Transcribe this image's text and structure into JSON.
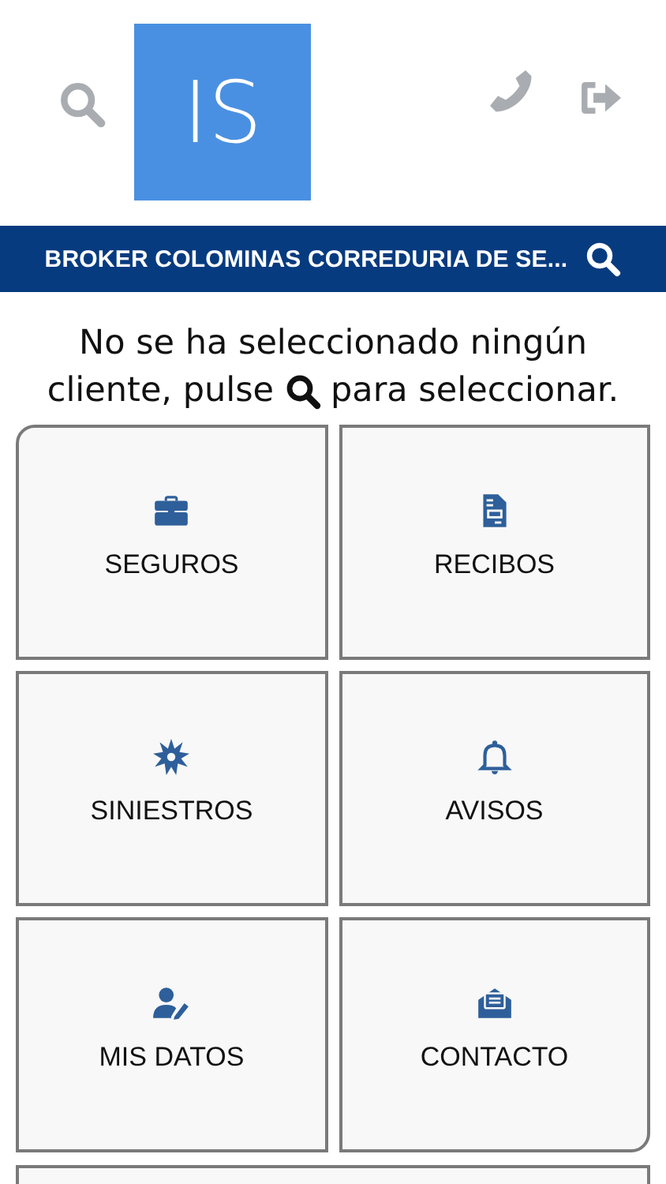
{
  "header": {
    "logo": "IS"
  },
  "client_bar": {
    "title": "BROKER COLOMINAS CORREDURIA DE SE..."
  },
  "message": {
    "line_1": "No se ha seleccionado ningún",
    "before_icon": "cliente, pulse",
    "after_icon": "para seleccionar."
  },
  "tiles": [
    {
      "label": "SEGUROS"
    },
    {
      "label": "RECIBOS"
    },
    {
      "label": "SINIESTROS"
    },
    {
      "label": "AVISOS"
    },
    {
      "label": "MIS DATOS"
    },
    {
      "label": "CONTACTO"
    }
  ]
}
